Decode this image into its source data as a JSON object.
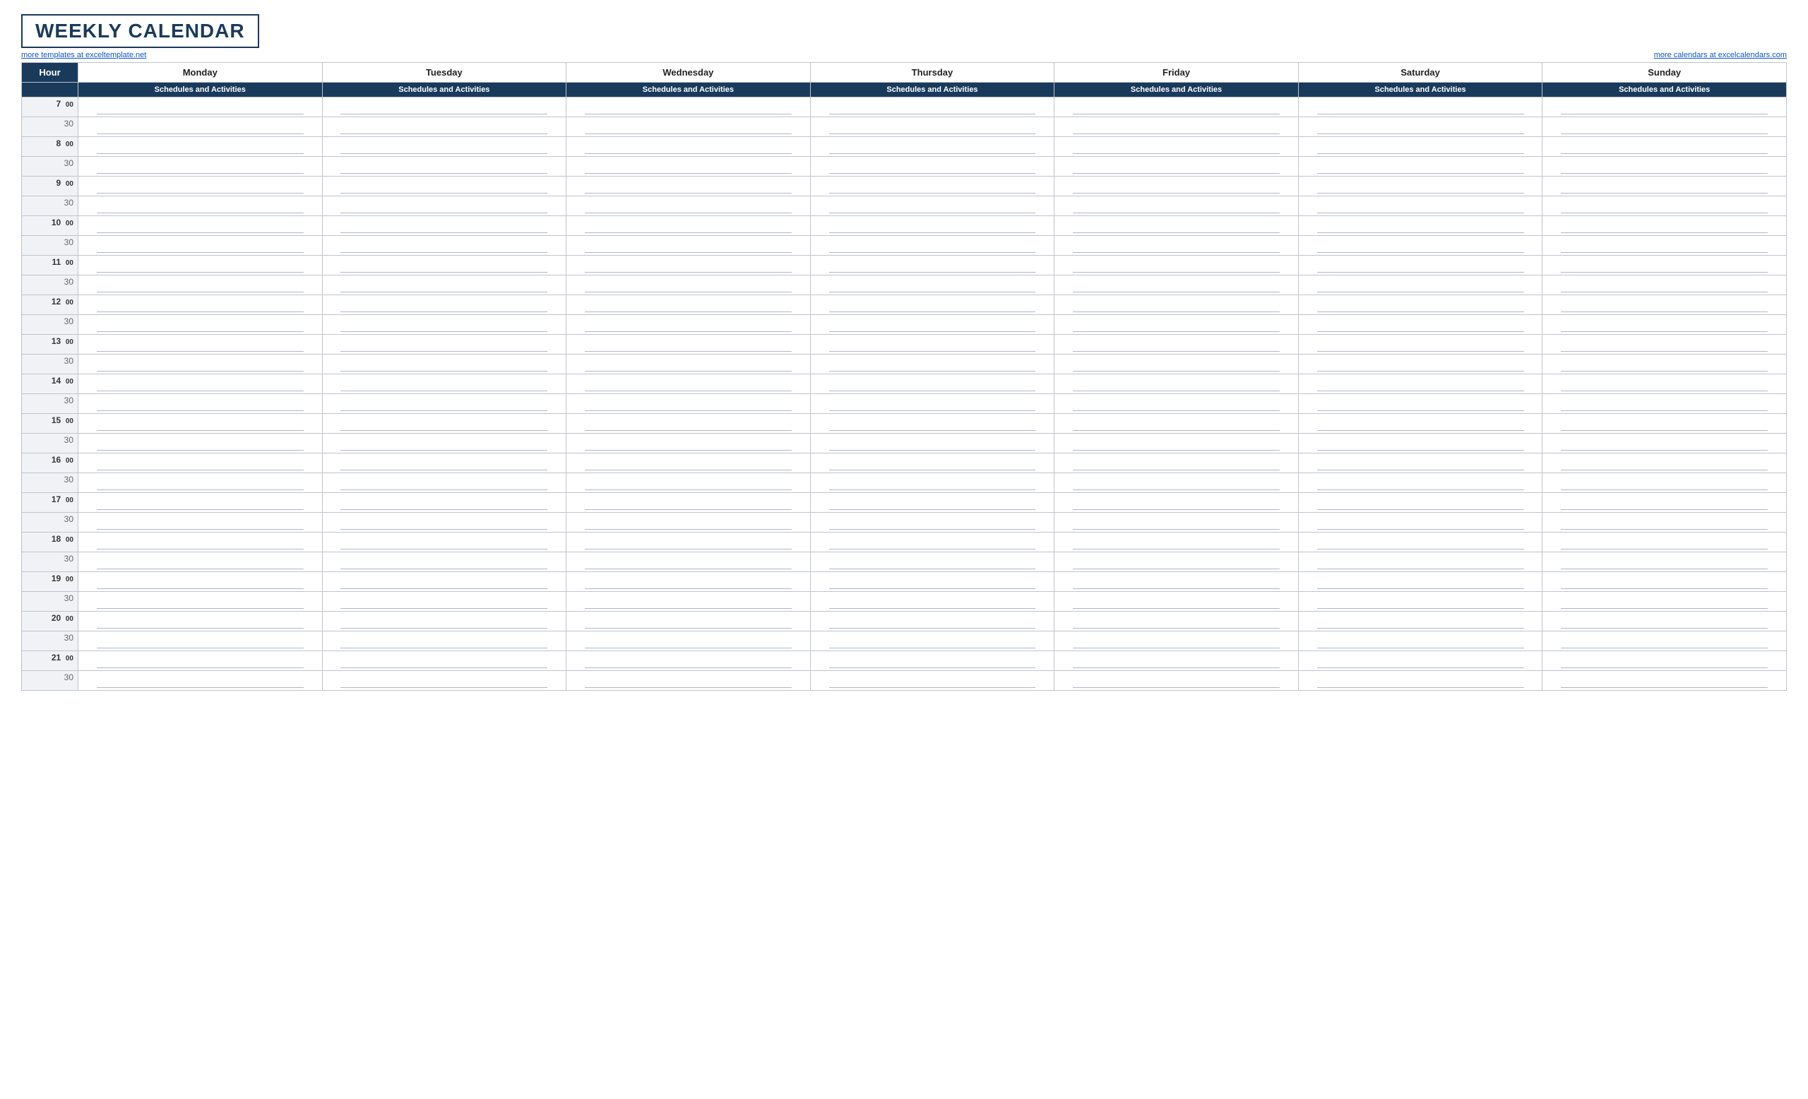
{
  "header": {
    "title": "WEEKLY CALENDAR",
    "link_left": "more templates at exceltemplate.net",
    "link_right": "more calendars at excelcalendars.com"
  },
  "table": {
    "hour_label": "Hour",
    "days": [
      "Monday",
      "Tuesday",
      "Wednesday",
      "Thursday",
      "Friday",
      "Saturday",
      "Sunday"
    ],
    "sub_header": "Schedules and Activities",
    "time_slots": [
      {
        "hour": "7",
        "minute": "00"
      },
      {
        "hour": "",
        "minute": "30"
      },
      {
        "hour": "8",
        "minute": "00"
      },
      {
        "hour": "",
        "minute": "30"
      },
      {
        "hour": "9",
        "minute": "00"
      },
      {
        "hour": "",
        "minute": "30"
      },
      {
        "hour": "10",
        "minute": "00"
      },
      {
        "hour": "",
        "minute": "30"
      },
      {
        "hour": "11",
        "minute": "00"
      },
      {
        "hour": "",
        "minute": "30"
      },
      {
        "hour": "12",
        "minute": "00"
      },
      {
        "hour": "",
        "minute": "30"
      },
      {
        "hour": "13",
        "minute": "00"
      },
      {
        "hour": "",
        "minute": "30"
      },
      {
        "hour": "14",
        "minute": "00"
      },
      {
        "hour": "",
        "minute": "30"
      },
      {
        "hour": "15",
        "minute": "00"
      },
      {
        "hour": "",
        "minute": "30"
      },
      {
        "hour": "16",
        "minute": "00"
      },
      {
        "hour": "",
        "minute": "30"
      },
      {
        "hour": "17",
        "minute": "00"
      },
      {
        "hour": "",
        "minute": "30"
      },
      {
        "hour": "18",
        "minute": "00"
      },
      {
        "hour": "",
        "minute": "30"
      },
      {
        "hour": "19",
        "minute": "00"
      },
      {
        "hour": "",
        "minute": "30"
      },
      {
        "hour": "20",
        "minute": "00"
      },
      {
        "hour": "",
        "minute": "30"
      },
      {
        "hour": "21",
        "minute": "00"
      },
      {
        "hour": "",
        "minute": "30"
      }
    ]
  }
}
